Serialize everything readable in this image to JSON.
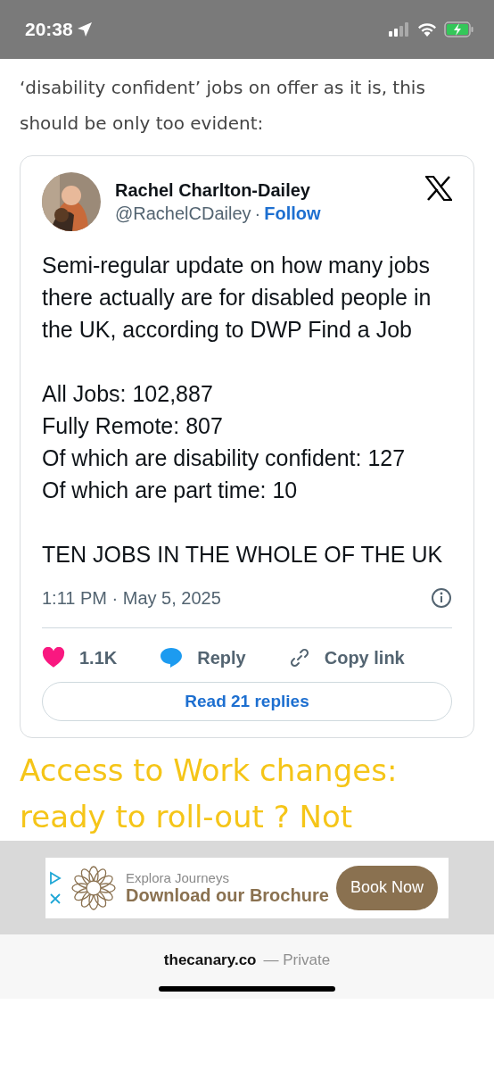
{
  "status_bar": {
    "time": "20:38"
  },
  "article_intro": "‘disability confident’ jobs on offer as it is, this should be only too evident:",
  "tweet": {
    "author": "Rachel Charlton-Dailey",
    "handle": "@RachelCDailey",
    "separator": "·",
    "follow": "Follow",
    "text": "Semi-regular update on how many jobs there actually are for disabled people in the UK, according to DWP Find a Job\n\nAll Jobs: 102,887\nFully Remote: 807\nOf which are disability confident: 127\nOf which are part time: 10\n\nTEN JOBS IN THE WHOLE OF THE UK",
    "timestamp": "1:11 PM · May 5, 2025",
    "actions": [
      {
        "kind": "like",
        "label": "1.1K"
      },
      {
        "kind": "reply",
        "label": "Reply"
      },
      {
        "kind": "copy",
        "label": "Copy link"
      }
    ],
    "read_replies": "Read 21 replies"
  },
  "heading": "Access to Work changes: ready to roll-out ? Not",
  "ad": {
    "brand": "Explora Journeys",
    "headline": "Download our Brochure",
    "button": "Book Now"
  },
  "browser_bar": {
    "domain": "thecanary.co",
    "mode": "— Private"
  }
}
